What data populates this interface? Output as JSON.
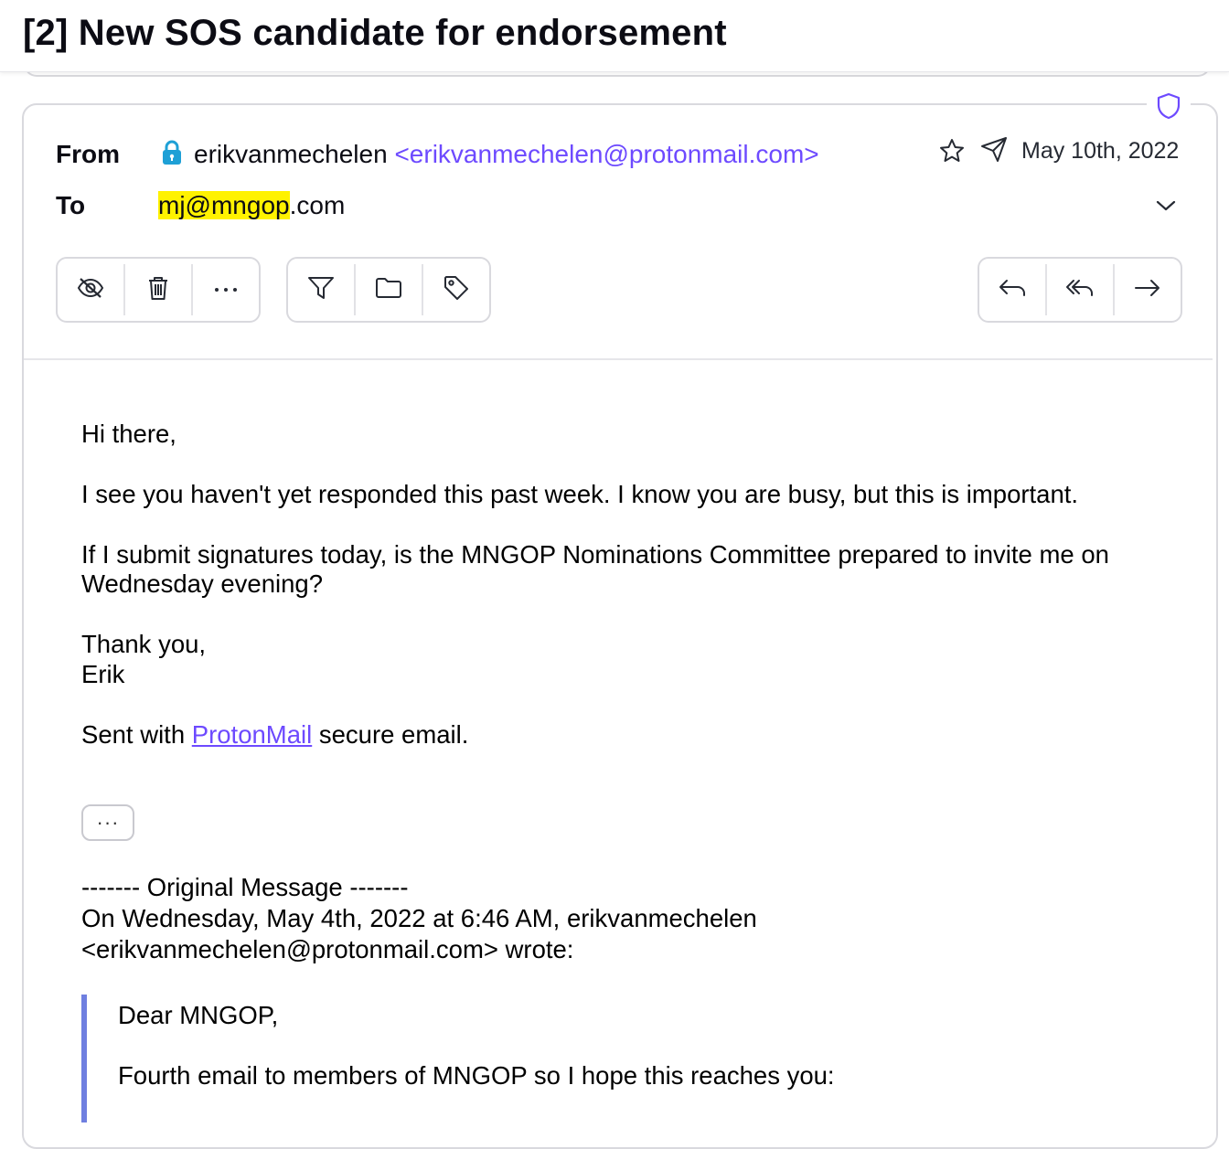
{
  "subject": "[2] New SOS candidate for endorsement",
  "header": {
    "from_label": "From",
    "to_label": "To",
    "sender_name": "erikvanmechelen",
    "sender_address": "<erikvanmechelen@protonmail.com>",
    "recipient_highlighted": "mj@mngop",
    "recipient_rest": ".com",
    "date": "May 10th, 2022"
  },
  "icons": {
    "shield": "shield-icon",
    "lock": "lock-icon",
    "star": "star-icon",
    "sent": "paper-plane-icon",
    "expand": "chevron-down-icon"
  },
  "toolbar": {
    "group1": [
      "eye-slash-icon",
      "trash-icon",
      "ellipsis-icon"
    ],
    "group2": [
      "filter-icon",
      "folder-icon",
      "tag-icon"
    ],
    "group3": [
      "reply-icon",
      "reply-all-icon",
      "forward-icon"
    ],
    "more_label": "···"
  },
  "body": {
    "greeting": "Hi there,",
    "para1": "I see you haven't yet responded this past week. I know you are busy, but this is important.",
    "para2_line1": "If I submit signatures today, is the MNGOP Nominations Committee prepared to invite me on",
    "para2_line2": "Wednesday evening?",
    "closing": "Thank you,",
    "signature": "Erik",
    "sent_prefix": "Sent with ",
    "sent_link": "ProtonMail",
    "sent_suffix": " secure email.",
    "show_more": "···",
    "original_header": "------- Original Message -------",
    "original_line1": "On Wednesday, May 4th, 2022 at 6:46 AM, erikvanmechelen",
    "original_line2": "<erikvanmechelen@protonmail.com> wrote:",
    "quote_greeting": "Dear MNGOP,",
    "quote_para1": "Fourth email to members of MNGOP so I hope this reaches you:"
  },
  "colors": {
    "accent": "#6d4aff",
    "highlight": "#fff200",
    "lock": "#1ea0d6",
    "quote_bar": "#6f7fe0"
  }
}
